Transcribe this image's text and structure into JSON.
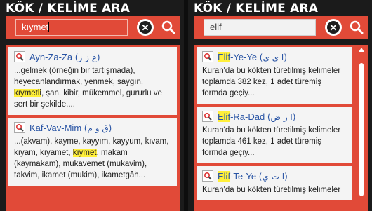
{
  "left": {
    "title": "KÖK / KELİME ARA",
    "query": "kıymet",
    "results": [
      {
        "root_latin": "Ayn-Za-Za",
        "root_arabic": "(ع ز ز)",
        "snippet_before": "...gelmek (örneğin bir tartışmada), heyecanlandırmak, yenmek, saygın, ",
        "snippet_match": "kıymetli",
        "snippet_after": ", şan, kibir, mükemmel, gururlu ve sert bir şekilde,..."
      },
      {
        "root_latin": "Kaf-Vav-Mim",
        "root_arabic": "(ق و م)",
        "snippet_before": "...(akvam), kayme, kayyım, kayyum, kıvam, kıyam, kıyamet, ",
        "snippet_match": "kıymet",
        "snippet_after": ", makam (kaymakam), mukavemet (mukavim), takvim, ikamet (mukim), ikametgâh..."
      }
    ]
  },
  "right": {
    "title": "KÖK / KELİME ARA",
    "query": "elif",
    "results": [
      {
        "root_match": "Elif",
        "root_rest": "-Ye-Ye",
        "root_arabic": "(ا ي ي)",
        "snippet": "Kuran'da bu kökten türetilmiş kelimeler toplamda 382 kez, 1 adet türemiş formda geçiy..."
      },
      {
        "root_match": "Elif",
        "root_rest": "-Ra-Dad",
        "root_arabic": "(ا ر ض)",
        "snippet": "Kuran'da bu kökten türetilmiş kelimeler toplamda 461 kez, 1 adet türemiş formda geçiy..."
      },
      {
        "root_match": "Elif",
        "root_rest": "-Te-Ye",
        "root_arabic": "(ا ت ي)",
        "snippet": "Kuran'da bu kökten türetilmiş kelimeler"
      }
    ]
  },
  "colors": {
    "accent": "#e14a38",
    "highlight": "#ffef3a",
    "link": "#2a55a5",
    "background": "#1b1b1b"
  },
  "icons": {
    "clear": "close-circle-icon",
    "search": "search-icon",
    "result": "magnifier-icon"
  }
}
